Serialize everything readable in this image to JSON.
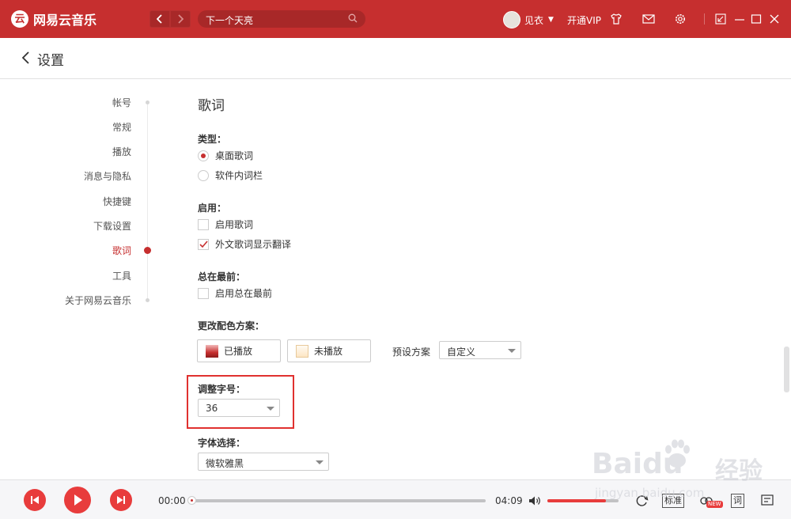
{
  "app": {
    "name": "网易云音乐",
    "logo_glyph": "云",
    "accent_color": "#c62f2f"
  },
  "topbar": {
    "search_text": "下一个天亮",
    "username": "见衣",
    "vip_label": "开通VIP",
    "icons": [
      "back-icon",
      "forward-icon",
      "search-icon",
      "skin-icon",
      "mail-icon",
      "gear-icon",
      "mini-mode-icon",
      "minimize-icon",
      "maximize-icon",
      "close-icon"
    ]
  },
  "header": {
    "title": "设置"
  },
  "sidenav": {
    "items": [
      "帐号",
      "常规",
      "播放",
      "消息与隐私",
      "快捷键",
      "下载设置",
      "歌词",
      "工具",
      "关于网易云音乐"
    ],
    "active": "歌词"
  },
  "lyrics": {
    "title": "歌词",
    "type_label": "类型：",
    "type_options": [
      "桌面歌词",
      "软件内词栏"
    ],
    "type_selected": "桌面歌词",
    "enable_label": "启用：",
    "enable_options": [
      {
        "label": "启用歌词",
        "checked": false
      },
      {
        "label": "外文歌词显示翻译",
        "checked": true
      }
    ],
    "ontop_label": "总在最前：",
    "ontop_option": {
      "label": "启用总在最前",
      "checked": false
    },
    "color_label": "更改配色方案：",
    "played_label": "已播放",
    "unplayed_label": "未播放",
    "preset_label": "预设方案",
    "preset_value": "自定义",
    "fontsize_label": "调整字号：",
    "fontsize_value": "36",
    "font_label": "字体选择：",
    "font_value": "微软雅黑"
  },
  "player": {
    "current_time": "00:00",
    "total_time": "04:09",
    "progress": 0,
    "volume": 0.82,
    "quality_label": "标准",
    "new_badge": "NEW",
    "lyric_button": "词"
  },
  "watermark": {
    "brand": "Baidu",
    "jingyan": "经验",
    "url": "jingyan.baidu.com"
  }
}
